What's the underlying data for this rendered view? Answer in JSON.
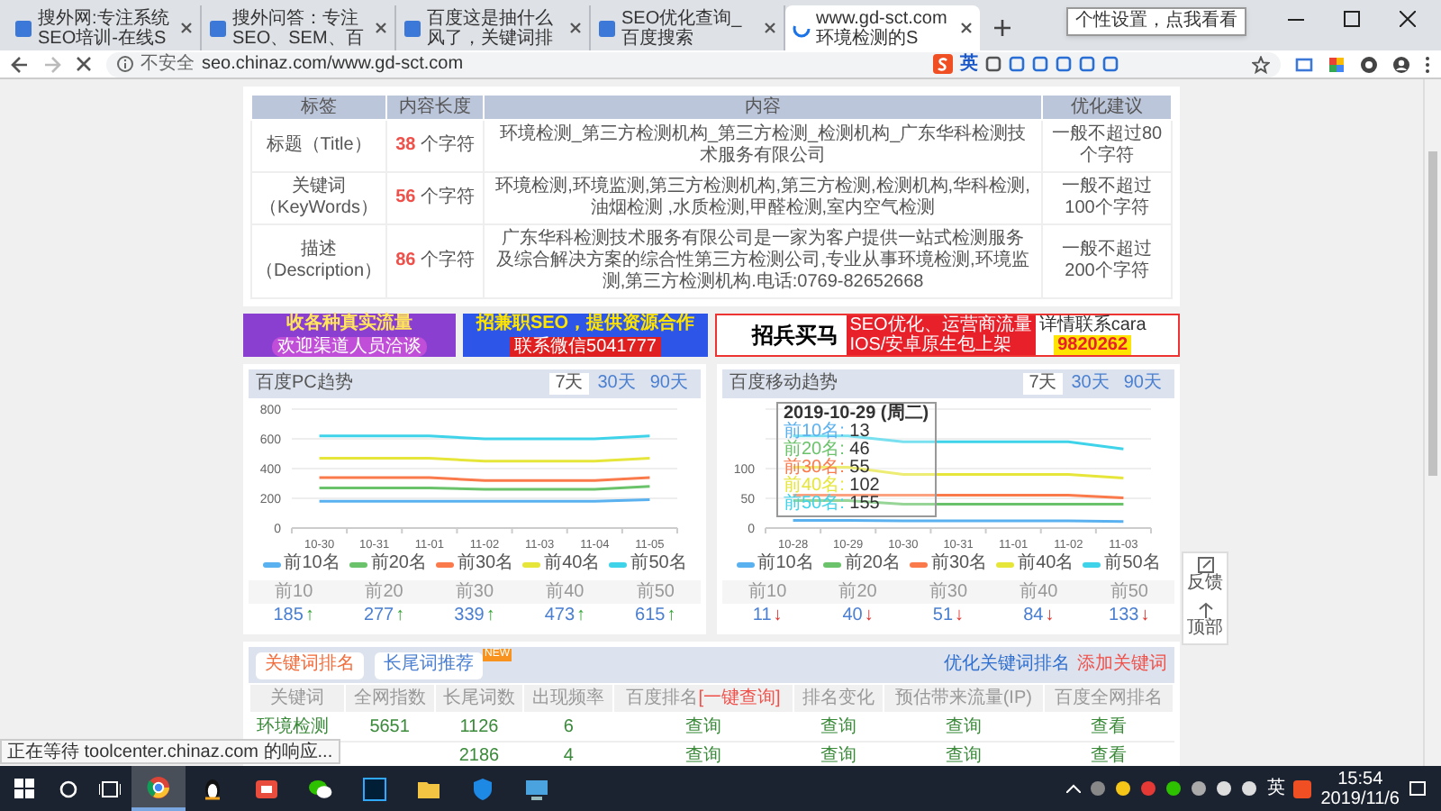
{
  "tabs": [
    {
      "title": "搜外网:专注系统SEO培训-在线S",
      "selected": false,
      "loading": false
    },
    {
      "title": "搜外问答：专注SEO、SEM、百",
      "selected": false,
      "loading": false
    },
    {
      "title": "百度这是抽什么风了，关键词排",
      "selected": false,
      "loading": false
    },
    {
      "title": "SEO优化查询_百度搜索",
      "selected": false,
      "loading": false
    },
    {
      "title": "www.gd-sct.com环境检测的S",
      "selected": true,
      "loading": true
    }
  ],
  "tooltip": "个性设置，点我看看",
  "address": {
    "security": "不安全",
    "url": "seo.chinaz.com/www.gd-sct.com",
    "ime": "英"
  },
  "meta_table": {
    "columns": [
      "标签",
      "内容长度",
      "内容",
      "优化建议"
    ],
    "rows": [
      {
        "label": "标题（Title）",
        "count": "38",
        "unit": "个字符",
        "content": "环境检测_第三方检测机构_第三方检测_检测机构_广东华科检测技术服务有限公司",
        "advice": "一般不超过80个字符"
      },
      {
        "label": "关键词（KeyWords）",
        "count": "56",
        "unit": "个字符",
        "content": "环境检测,环境监测,第三方检测机构,第三方检测,检测机构,华科检测,油烟检测 ,水质检测,甲醛检测,室内空气检测",
        "advice": "一般不超过100个字符"
      },
      {
        "label": "描述（Description）",
        "count": "86",
        "unit": "个字符",
        "content": "广东华科检测技术服务有限公司是一家为客户提供一站式检测服务及综合解决方案的综合性第三方检测公司,专业从事环境检测,环境监测,第三方检测机构.电话:0769-82652668",
        "advice": "一般不超过200个字符"
      }
    ]
  },
  "ads": [
    {
      "texts": [
        "收各种真实流量",
        "欢迎渠道人员洽谈"
      ]
    },
    {
      "texts": [
        "招兼职SEO，提供资源合作",
        "联系微信5041777"
      ]
    },
    {
      "texts": [
        "招兵买马",
        "SEO优化、运营商流量",
        "IOS/安卓原生包上架",
        "详情联系cara",
        "9820262"
      ]
    }
  ],
  "trends": [
    {
      "title": "百度PC趋势",
      "ranges": [
        {
          "label": "7天",
          "selected": true
        },
        {
          "label": "30天",
          "selected": false
        },
        {
          "label": "90天",
          "selected": false
        }
      ],
      "chart_data": {
        "type": "line",
        "grid": true,
        "categories": [
          "10-30",
          "10-31",
          "11-01",
          "11-02",
          "11-03",
          "11-04",
          "11-05"
        ],
        "ylim": [
          0,
          800
        ],
        "yticks": [
          0,
          200,
          400,
          600,
          800
        ],
        "series": [
          {
            "name": "前10名",
            "color": "#5ab1ef",
            "values": [
              180,
              180,
              180,
              180,
              180,
              180,
              190
            ]
          },
          {
            "name": "前20名",
            "color": "#6ac36a",
            "values": [
              270,
              270,
              270,
              260,
              260,
              260,
              280
            ]
          },
          {
            "name": "前30名",
            "color": "#fb7a4b",
            "values": [
              340,
              340,
              340,
              320,
              320,
              320,
              340
            ]
          },
          {
            "name": "前40名",
            "color": "#e6e63a",
            "values": [
              470,
              470,
              470,
              450,
              450,
              450,
              470
            ]
          },
          {
            "name": "前50名",
            "color": "#3fd3ea",
            "values": [
              620,
              620,
              620,
              600,
              600,
              600,
              620
            ]
          }
        ]
      },
      "stats": [
        {
          "label": "前10",
          "value": "185",
          "arrow": "↑",
          "rising": true
        },
        {
          "label": "前20",
          "value": "277",
          "arrow": "↑",
          "rising": true
        },
        {
          "label": "前30",
          "value": "339",
          "arrow": "↑",
          "rising": true
        },
        {
          "label": "前40",
          "value": "473",
          "arrow": "↑",
          "rising": true
        },
        {
          "label": "前50",
          "value": "615",
          "arrow": "↑",
          "rising": true
        }
      ]
    },
    {
      "title": "百度移动趋势",
      "ranges": [
        {
          "label": "7天",
          "selected": true
        },
        {
          "label": "30天",
          "selected": false
        },
        {
          "label": "90天",
          "selected": false
        }
      ],
      "chart_data": {
        "type": "line",
        "grid": true,
        "categories": [
          "10-28",
          "10-29",
          "10-30",
          "10-31",
          "11-01",
          "11-02",
          "11-03"
        ],
        "ylim": [
          0,
          200
        ],
        "yticks": [
          0,
          50,
          100
        ],
        "series": [
          {
            "name": "前10名",
            "color": "#5ab1ef",
            "values": [
              13,
              13,
              12,
              12,
              12,
              12,
              11
            ]
          },
          {
            "name": "前20名",
            "color": "#6ac36a",
            "values": [
              46,
              46,
              40,
              40,
              40,
              40,
              40
            ]
          },
          {
            "name": "前30名",
            "color": "#fb7a4b",
            "values": [
              55,
              55,
              55,
              55,
              55,
              55,
              51
            ]
          },
          {
            "name": "前40名",
            "color": "#e6e63a",
            "values": [
              102,
              102,
              90,
              90,
              90,
              90,
              84
            ]
          },
          {
            "name": "前50名",
            "color": "#3fd3ea",
            "values": [
              155,
              155,
              145,
              145,
              145,
              145,
              133
            ]
          }
        ],
        "ylabel": null
      },
      "tooltip": {
        "title": "2019-10-29 (周二)",
        "rows": [
          {
            "label": "前10名:",
            "value": "13"
          },
          {
            "label": "前20名:",
            "value": "46"
          },
          {
            "label": "前30名:",
            "value": "55"
          },
          {
            "label": "前40名:",
            "value": "102"
          },
          {
            "label": "前50名:",
            "value": "155"
          }
        ]
      },
      "stats": [
        {
          "label": "前10",
          "value": "11",
          "arrow": "↓",
          "rising": false
        },
        {
          "label": "前20",
          "value": "40",
          "arrow": "↓",
          "rising": false
        },
        {
          "label": "前30",
          "value": "51",
          "arrow": "↓",
          "rising": false
        },
        {
          "label": "前40",
          "value": "84",
          "arrow": "↓",
          "rising": false
        },
        {
          "label": "前50",
          "value": "133",
          "arrow": "↓",
          "rising": false
        }
      ]
    }
  ],
  "keywords": {
    "tabs": [
      {
        "label": "关键词排名",
        "selected": true
      },
      {
        "label": "长尾词推荐",
        "selected": false,
        "badge": "NEW"
      }
    ],
    "links": [
      {
        "label": "优化关键词排名",
        "kind": "primary"
      },
      {
        "label": "添加关键词",
        "kind": "accent"
      }
    ],
    "columns": [
      {
        "label": "关键词"
      },
      {
        "label": "全网指数"
      },
      {
        "label": "长尾词数"
      },
      {
        "label": "出现频率"
      },
      {
        "label": "百度排名",
        "action": "[一键查询]"
      },
      {
        "label": "排名变化"
      },
      {
        "label": "预估带来流量(IP)"
      },
      {
        "label": "百度全网排名"
      }
    ],
    "rows": [
      {
        "cells": [
          "环境检测",
          "5651",
          "1126",
          "6",
          "查询",
          "查询",
          "查询",
          "查看"
        ]
      },
      {
        "cells": [
          null,
          null,
          "2186",
          "4",
          "查询",
          "查询",
          "查询",
          "查看"
        ]
      }
    ]
  },
  "side_widget": [
    {
      "label": "反馈",
      "kind": "feedback"
    },
    {
      "label": "顶部",
      "kind": "top"
    }
  ],
  "status_text": "正在等待 toolcenter.chinaz.com 的响应...",
  "taskbar": {
    "ime": "英",
    "time": "15:54",
    "date": "2019/11/6"
  }
}
